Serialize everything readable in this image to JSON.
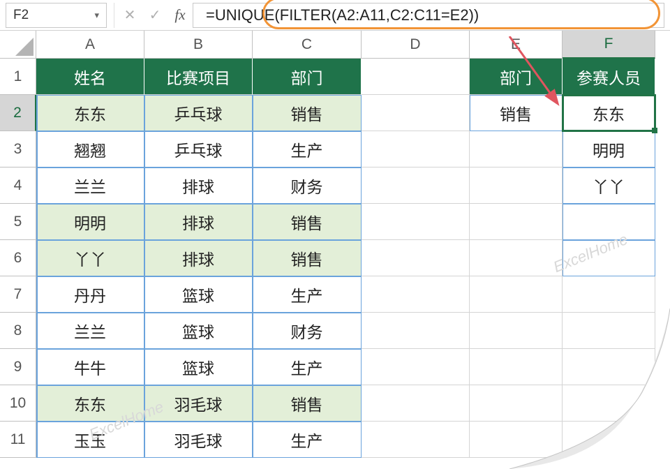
{
  "nameBox": {
    "value": "F2"
  },
  "formulaBar": {
    "cancelGlyph": "✕",
    "confirmGlyph": "✓",
    "fxLabel": "fx",
    "valueSegments": [
      {
        "text": "=UNIQUE("
      },
      {
        "text": "FILTER"
      },
      {
        "text": "(A2:A11,C2:C11=E2))"
      }
    ]
  },
  "columns": [
    "A",
    "B",
    "C",
    "D",
    "E",
    "F"
  ],
  "rowNumbers": [
    "1",
    "2",
    "3",
    "4",
    "5",
    "6",
    "7",
    "8",
    "9",
    "10",
    "11"
  ],
  "activeCell": "F2",
  "headers": {
    "A": "姓名",
    "B": "比赛项目",
    "C": "部门",
    "E": "部门",
    "F": "参赛人员"
  },
  "data": [
    {
      "A": "东东",
      "B": "乒乓球",
      "C": "销售",
      "hl": true
    },
    {
      "A": "翘翘",
      "B": "乒乓球",
      "C": "生产",
      "hl": false
    },
    {
      "A": "兰兰",
      "B": "排球",
      "C": "财务",
      "hl": false
    },
    {
      "A": "明明",
      "B": "排球",
      "C": "销售",
      "hl": true
    },
    {
      "A": "丫丫",
      "B": "排球",
      "C": "销售",
      "hl": true
    },
    {
      "A": "丹丹",
      "B": "篮球",
      "C": "生产",
      "hl": false
    },
    {
      "A": "兰兰",
      "B": "篮球",
      "C": "财务",
      "hl": false
    },
    {
      "A": "牛牛",
      "B": "篮球",
      "C": "生产",
      "hl": false
    },
    {
      "A": "东东",
      "B": "羽毛球",
      "C": "销售",
      "hl": true
    },
    {
      "A": "玉玉",
      "B": "羽毛球",
      "C": "生产",
      "hl": false
    }
  ],
  "lookup": {
    "E2": "销售"
  },
  "results": [
    "东东",
    "明明",
    "丫丫"
  ],
  "watermark": "ExcelHome"
}
